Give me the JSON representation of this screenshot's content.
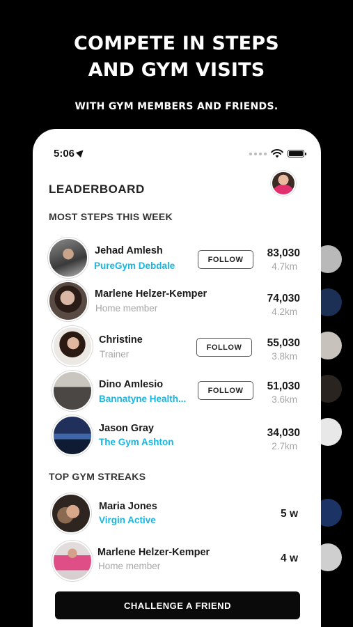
{
  "promo": {
    "headline_line1": "COMPETE IN STEPS",
    "headline_line2": "AND GYM VISITS",
    "subline": "WITH GYM MEMBERS AND FRIENDS."
  },
  "status_bar": {
    "time": "5:06"
  },
  "leaderboard": {
    "title": "LEADERBOARD",
    "steps_section_title": "MOST STEPS THIS WEEK",
    "steps_rows": [
      {
        "name": "Jehad Amlesh",
        "subtitle": "PureGym Debdale",
        "subtitle_type": "gym",
        "follow_label": "FOLLOW",
        "steps": "83,030",
        "distance": "4.7km"
      },
      {
        "name": "Marlene Helzer-Kemper",
        "subtitle": "Home member",
        "subtitle_type": "muted",
        "follow_label": "",
        "steps": "74,030",
        "distance": "4.2km"
      },
      {
        "name": "Christine",
        "subtitle": "Trainer",
        "subtitle_type": "muted",
        "follow_label": "FOLLOW",
        "steps": "55,030",
        "distance": "3.8km"
      },
      {
        "name": "Dino Amlesio",
        "subtitle": "Bannatyne Health...",
        "subtitle_type": "gym",
        "follow_label": "FOLLOW",
        "steps": "51,030",
        "distance": "3.6km"
      },
      {
        "name": "Jason Gray",
        "subtitle": "The Gym Ashton",
        "subtitle_type": "gym",
        "follow_label": "",
        "steps": "34,030",
        "distance": "2.7km"
      }
    ],
    "streaks_section_title": "TOP GYM STREAKS",
    "streak_rows": [
      {
        "name": "Maria Jones",
        "subtitle": "Virgin Active",
        "subtitle_type": "gym",
        "streak": "5 w"
      },
      {
        "name": "Marlene Helzer-Kemper",
        "subtitle": "Home member",
        "subtitle_type": "muted",
        "streak": "4 w"
      }
    ],
    "cta_label": "CHALLENGE A FRIEND"
  },
  "colors": {
    "gym_link": "#16b6e0",
    "muted": "#a6a6a6",
    "cta_bg": "#0a0a0a"
  }
}
